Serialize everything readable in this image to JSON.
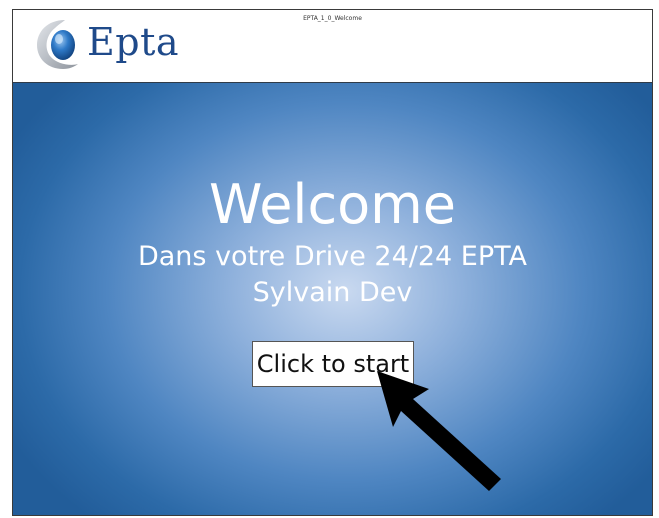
{
  "screen": {
    "id_label": "EPTA_1_0_Welcome"
  },
  "brand": {
    "name": "Epta",
    "logo_icon": "epta-crescent-logo-icon",
    "color": "#1f4a8a"
  },
  "hero": {
    "title": "Welcome",
    "subtitle": "Dans votre Drive 24/24 EPTA",
    "user_name": "Sylvain Dev",
    "background_colors": [
      "#c9d9f0",
      "#4f86c2",
      "#225d9a"
    ]
  },
  "actions": {
    "start_label": "Click to start"
  },
  "annotations": {
    "pointer_icon": "arrow-pointer-icon",
    "pointer_color": "#000000"
  }
}
